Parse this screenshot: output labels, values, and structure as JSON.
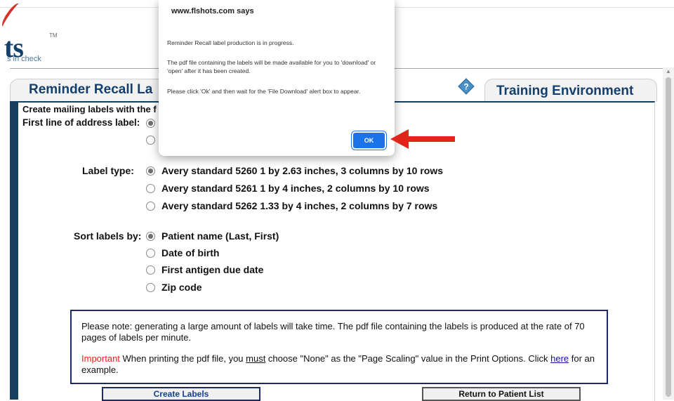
{
  "logo": {
    "text": "ts",
    "tm": "TM",
    "tagline": "s in check"
  },
  "header": {
    "left_title": "Reminder Recall La",
    "right_title": "Training Environment",
    "help_icon": "help-diamond-icon"
  },
  "form": {
    "intro": "Create mailing labels with the f",
    "first_line_label": "First line of address label:",
    "label_type_label": "Label type:",
    "label_types": [
      "Avery standard 5260 1 by 2.63 inches, 3 columns by 10 rows",
      "Avery standard 5261 1 by 4 inches, 2 columns by 10 rows",
      "Avery standard 5262 1.33 by 4 inches, 2 columns by 7 rows"
    ],
    "sort_label": "Sort labels by:",
    "sort_options": [
      "Patient name (Last, First)",
      "Date of birth",
      "First antigen due date",
      "Zip code"
    ]
  },
  "note": {
    "p1": "Please note: generating a large amount of labels will take time.  The pdf file containing the labels is produced at the rate of 70 pages of labels per minute.",
    "important": "Important",
    "p2a": " When printing the pdf file, you ",
    "must": "must",
    "p2b": " choose \"None\" as the \"Page Scaling\" value in the Print Options.  Click ",
    "here": "here",
    "p2c": " for an example."
  },
  "buttons": {
    "create": "Create Labels",
    "return": "Return to Patient List"
  },
  "dialog": {
    "title": "www.flshots.com says",
    "line1": "Reminder Recall label production is in progress.",
    "line2": "The pdf file containing the labels will be made available for you to 'download' or 'open' after it has been created.",
    "line3": "Please click 'Ok' and then wait for the 'File Download' alert box to appear.",
    "ok": "OK"
  },
  "colors": {
    "navy": "#173f5e",
    "title_blue": "#123f6b",
    "ok_blue": "#1a73e8",
    "arrow_red": "#e0261b",
    "important_red": "#e0261b"
  }
}
